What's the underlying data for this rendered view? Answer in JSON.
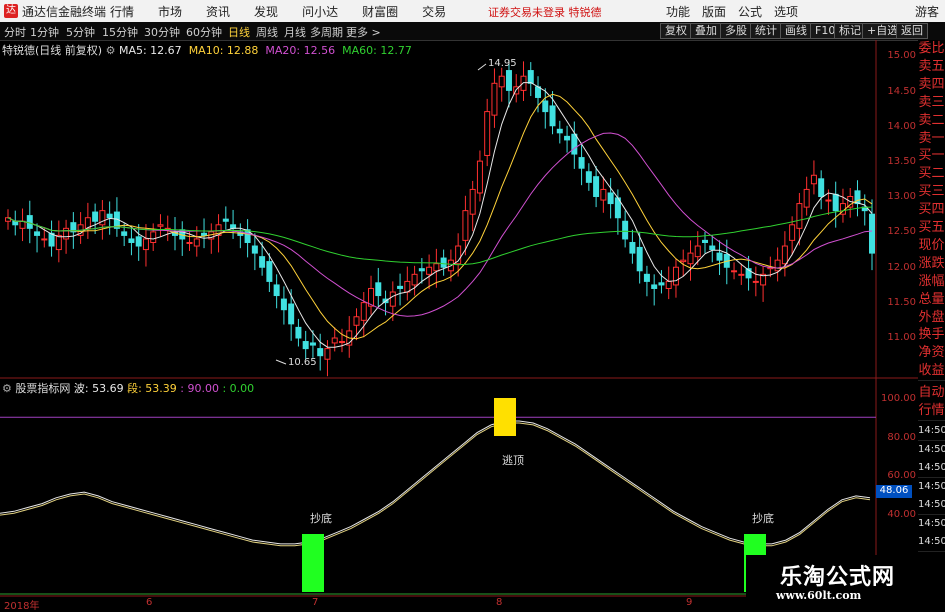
{
  "app": {
    "title": "通达信金融终端",
    "menu": [
      "行情",
      "市场",
      "资讯",
      "发现",
      "问小达",
      "财富圈",
      "交易"
    ],
    "notice": "证券交易未登录",
    "stock_name_red": "特锐德",
    "right_menu": [
      "功能",
      "版面",
      "公式",
      "选项"
    ],
    "guest": "游客"
  },
  "timeframes": [
    "分时",
    "1分钟",
    "5分钟",
    "15分钟",
    "30分钟",
    "60分钟",
    "日线",
    "周线",
    "月线",
    "多周期",
    "更多 >"
  ],
  "active_timeframe": "日线",
  "toolbar_right": [
    "复权",
    "叠加",
    "多股",
    "统计",
    "画线",
    "F10",
    "标记",
    "+自选",
    "返回"
  ],
  "main_legend": {
    "name": "特锐德(日线 前复权)",
    "ma": [
      {
        "label": "MA5: 12.67",
        "color": "#e8e8e8"
      },
      {
        "label": "MA10: 12.88",
        "color": "#ffd23a"
      },
      {
        "label": "MA20: 12.56",
        "color": "#d050d0"
      },
      {
        "label": "MA60: 12.77",
        "color": "#30d030"
      }
    ]
  },
  "sub_legend": {
    "name": "股票指标网",
    "items": [
      {
        "label": "波: 53.69",
        "color": "#e8e8e8"
      },
      {
        "label": "段: 53.39",
        "color": "#ffd23a"
      },
      {
        "label": ": 90.00",
        "color": "#d050d0"
      },
      {
        "label": ": 0.00",
        "color": "#30d030"
      }
    ]
  },
  "price_axis": [
    "15.00",
    "14.50",
    "14.00",
    "13.50",
    "13.00",
    "12.50",
    "12.00",
    "11.50",
    "11.00"
  ],
  "indicator_axis": [
    "100.00",
    "80.00",
    "60.00",
    "40.00"
  ],
  "indicator_current": "48.06",
  "annotations": {
    "high": "14.95",
    "low": "10.65"
  },
  "date_axis": [
    "2018年",
    "6",
    "7",
    "8",
    "9"
  ],
  "signals": {
    "bottom1": "抄底",
    "top": "逃顶",
    "bottom2": "抄底"
  },
  "side_panel": [
    "委比",
    "卖五",
    "卖四",
    "卖三",
    "卖二",
    "卖一",
    "买一",
    "买二",
    "买三",
    "买四",
    "买五",
    "现价",
    "涨跌",
    "涨幅",
    "总量",
    "外盘",
    "换手",
    "净资",
    "收益"
  ],
  "side_panel_lower": [
    "自动",
    "行情"
  ],
  "side_times": [
    "14:50",
    "14:50",
    "14:50",
    "14:50",
    "14:50",
    "14:50",
    "14:50",
    "14:50"
  ],
  "watermark": {
    "cn": "乐淘公式网",
    "url": "www.60lt.com"
  },
  "chart_data": {
    "type": "candlestick",
    "series": [
      {
        "name": "MA5",
        "values": []
      },
      {
        "name": "MA10",
        "values": []
      },
      {
        "name": "MA20",
        "values": []
      },
      {
        "name": "MA60",
        "values": []
      }
    ],
    "closes": [
      12.7,
      12.6,
      12.65,
      12.55,
      12.45,
      12.4,
      12.3,
      12.45,
      12.55,
      12.5,
      12.6,
      12.7,
      12.65,
      12.8,
      12.7,
      12.55,
      12.45,
      12.35,
      12.3,
      12.4,
      12.5,
      12.6,
      12.55,
      12.45,
      12.4,
      12.35,
      12.4,
      12.45,
      12.5,
      12.6,
      12.65,
      12.55,
      12.45,
      12.35,
      12.2,
      12.0,
      11.8,
      11.6,
      11.4,
      11.2,
      11.0,
      10.85,
      10.9,
      10.75,
      10.85,
      11.0,
      10.95,
      11.1,
      11.3,
      11.5,
      11.7,
      11.6,
      11.5,
      11.65,
      11.7,
      11.8,
      11.9,
      11.95,
      12.0,
      12.05,
      12.0,
      12.1,
      12.3,
      12.8,
      13.1,
      13.5,
      14.2,
      14.6,
      14.7,
      14.5,
      14.55,
      14.7,
      14.6,
      14.4,
      14.2,
      14.0,
      13.9,
      13.8,
      13.6,
      13.4,
      13.2,
      13.0,
      13.1,
      12.9,
      12.7,
      12.4,
      12.2,
      11.95,
      11.8,
      11.7,
      11.75,
      11.8,
      12.0,
      12.1,
      12.2,
      12.3,
      12.35,
      12.25,
      12.1,
      12.0,
      11.95,
      11.9,
      11.85,
      11.8,
      11.9,
      12.0,
      12.1,
      12.3,
      12.6,
      12.9,
      13.1,
      13.3,
      13.0,
      12.95,
      12.8,
      12.9,
      13.0,
      12.9,
      12.8,
      12.2
    ],
    "indicator": {
      "wave": [
        40,
        41,
        43,
        45,
        48,
        50,
        51,
        49,
        46,
        44,
        42,
        40,
        38,
        36,
        34,
        32,
        30,
        28,
        26,
        25,
        24,
        24,
        25,
        27,
        30,
        33,
        37,
        41,
        46,
        52,
        58,
        64,
        70,
        76,
        82,
        86,
        88,
        88,
        87,
        84,
        80,
        76,
        71,
        66,
        61,
        56,
        51,
        46,
        41,
        37,
        33,
        30,
        27,
        25,
        24,
        24,
        26,
        30,
        36,
        42,
        47,
        49,
        48
      ],
      "segment": [
        39,
        40,
        42,
        44,
        47,
        49,
        50,
        48,
        45,
        43,
        41,
        39,
        37,
        35,
        33,
        31,
        29,
        27,
        25,
        24,
        23,
        23,
        24,
        26,
        29,
        32,
        36,
        40,
        45,
        51,
        57,
        63,
        69,
        75,
        81,
        85,
        87,
        87,
        86,
        83,
        79,
        75,
        70,
        65,
        60,
        55,
        50,
        45,
        40,
        36,
        32,
        29,
        26,
        24,
        23,
        23,
        25,
        29,
        35,
        41,
        46,
        48,
        47
      ],
      "upper": 90,
      "lower": 0
    }
  }
}
